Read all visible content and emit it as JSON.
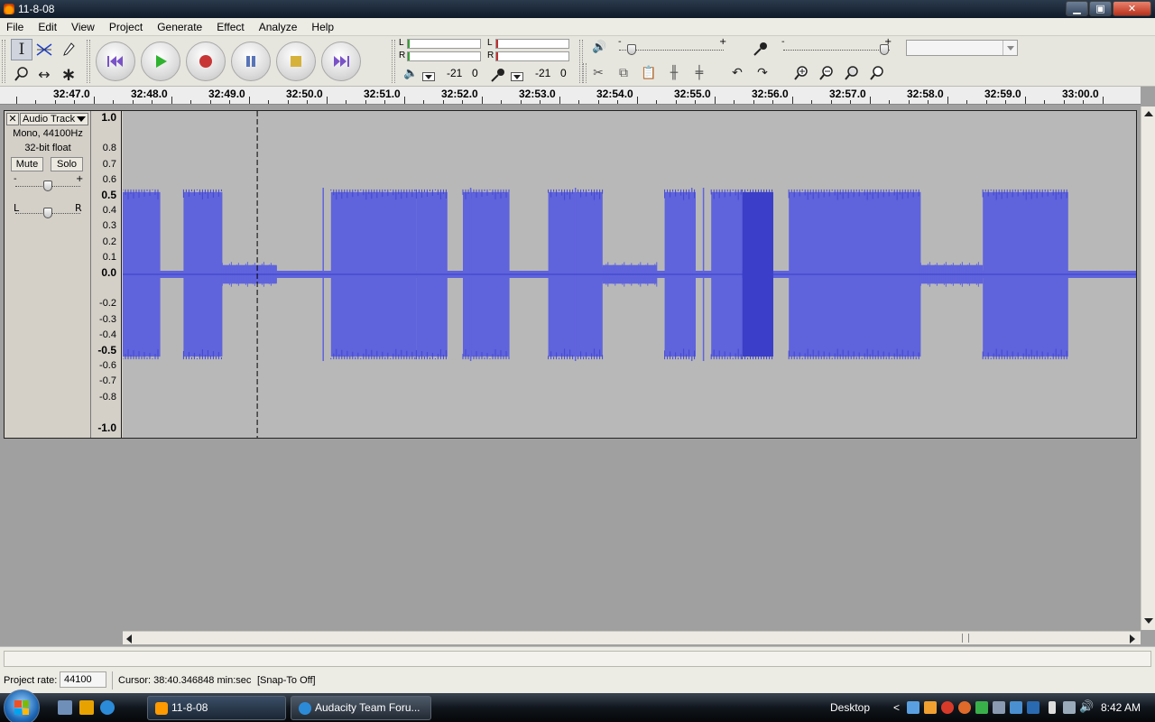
{
  "window": {
    "title": "11-8-08",
    "controls": {
      "minimize": "▁",
      "maximize": "▣",
      "close": "✕"
    }
  },
  "menu": [
    "File",
    "Edit",
    "View",
    "Project",
    "Generate",
    "Effect",
    "Analyze",
    "Help"
  ],
  "tools": {
    "selection": "selection-tool-icon",
    "envelope": "envelope-tool-icon",
    "draw": "draw-tool-icon",
    "zoom": "zoom-tool-icon",
    "timeshift": "time-shift-tool-icon",
    "multi": "multi-tool-icon"
  },
  "transport": [
    "skip-start",
    "play",
    "record",
    "pause",
    "stop",
    "skip-end"
  ],
  "meters": {
    "play": {
      "left": "L",
      "right": "R",
      "db": "-21",
      "zero": "0"
    },
    "record": {
      "left": "L",
      "right": "R",
      "db": "-21",
      "zero": "0"
    }
  },
  "mixer": {
    "output_minus": "-",
    "output_plus": "+",
    "input_minus": "-",
    "input_plus": "+",
    "output_volume": 0.12,
    "input_volume": 0.95
  },
  "ruler_labels": [
    "32:47.0",
    "32:48.0",
    "32:49.0",
    "32:50.0",
    "32:51.0",
    "32:52.0",
    "32:53.0",
    "32:54.0",
    "32:55.0",
    "32:56.0",
    "32:57.0",
    "32:58.0",
    "32:59.0",
    "33:00.0"
  ],
  "track": {
    "close": "✕",
    "name": "Audio Track",
    "info_channels": "Mono, 44100Hz",
    "info_format": "32-bit float",
    "mute": "Mute",
    "solo": "Solo",
    "gain_minus": "-",
    "gain_plus": "+",
    "pan_left": "L",
    "pan_right": "R",
    "gain": 0.5,
    "pan": 0.5
  },
  "amplitude_labels": [
    "1.0",
    "0.8",
    "0.7",
    "0.6",
    "0.5",
    "0.4",
    "0.3",
    "0.2",
    "0.1",
    "0.0",
    "-0.2",
    "-0.3",
    "-0.4",
    "-0.5",
    "-0.6",
    "-0.7",
    "-0.8",
    "-1.0"
  ],
  "waveform": {
    "color": "#5f63dc",
    "dark_color": "#3a3ec8",
    "cursor_time": "32:49.3",
    "segments": [
      {
        "start": 32.47,
        "end": 32.481,
        "amp": 0.53,
        "kind": "loud"
      },
      {
        "start": 32.484,
        "end": 32.489,
        "amp": 0.53,
        "kind": "loud"
      },
      {
        "start": 32.489,
        "end": 32.496,
        "amp": 0.06,
        "kind": "quiet"
      },
      {
        "start": 32.503,
        "end": 32.514,
        "amp": 0.53,
        "kind": "loud"
      },
      {
        "start": 32.514,
        "end": 32.518,
        "amp": 0.53,
        "kind": "loud"
      },
      {
        "start": 32.52,
        "end": 32.526,
        "amp": 0.53,
        "kind": "loud"
      },
      {
        "start": 32.531,
        "end": 32.538,
        "amp": 0.53,
        "kind": "loud"
      },
      {
        "start": 32.538,
        "end": 32.545,
        "amp": 0.06,
        "kind": "quiet"
      },
      {
        "start": 32.546,
        "end": 32.55,
        "amp": 0.53,
        "kind": "loud"
      },
      {
        "start": 32.552,
        "end": 32.556,
        "amp": 0.53,
        "kind": "loud"
      },
      {
        "start": 32.556,
        "end": 32.56,
        "amp": 0.53,
        "kind": "dark"
      },
      {
        "start": 32.562,
        "end": 32.579,
        "amp": 0.53,
        "kind": "loud"
      },
      {
        "start": 32.579,
        "end": 32.587,
        "amp": 0.06,
        "kind": "quiet"
      },
      {
        "start": 32.587,
        "end": 32.598,
        "amp": 0.53,
        "kind": "loud"
      }
    ]
  },
  "status": {
    "project_rate_label": "Project rate:",
    "project_rate": "44100",
    "cursor": "Cursor: 38:40.346848 min:sec",
    "snap": "[Snap-To Off]"
  },
  "taskbar": {
    "tasks": [
      "11-8-08",
      "Audacity Team Foru..."
    ],
    "desktop": "Desktop",
    "chevron": "<",
    "clock": "8:42 AM"
  }
}
